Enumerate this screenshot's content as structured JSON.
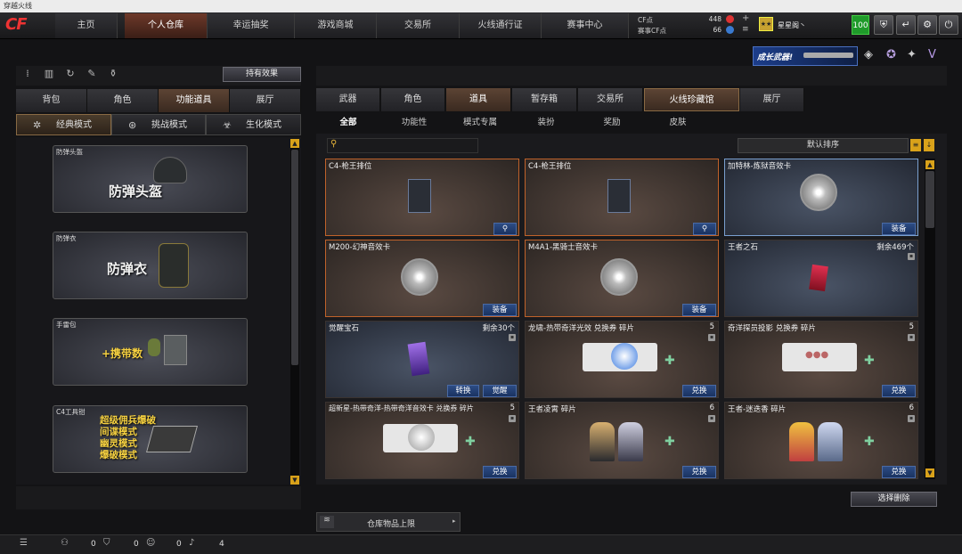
{
  "window": {
    "title": "穿越火线"
  },
  "logo": "CF",
  "nav": {
    "tabs": [
      "主页",
      "个人仓库",
      "幸运抽奖",
      "游戏商城",
      "交易所",
      "火线通行证",
      "赛事中心"
    ]
  },
  "currency": {
    "cf_label": "CF点",
    "cf_value": "448",
    "event_label": "赛事CF点",
    "event_value": "66"
  },
  "user": {
    "name": "星星阁丶",
    "level": "100"
  },
  "left": {
    "effect_button": "持有效果",
    "tabs": [
      "背包",
      "角色",
      "功能道具",
      "展厅"
    ],
    "modes": [
      "经典模式",
      "挑战模式",
      "生化模式"
    ],
    "cards": [
      {
        "label": "防弹头盔",
        "text": "防弹头盔"
      },
      {
        "label": "防弹衣",
        "text": "防弹衣"
      },
      {
        "label": "手雷包",
        "text": "+携带数"
      },
      {
        "label": "C4工具钳",
        "lines": [
          "超级佣兵爆破",
          "间谍模式",
          "幽灵模式",
          "爆破模式"
        ]
      }
    ]
  },
  "banner": {
    "text": "成长武器!"
  },
  "right": {
    "tabs": [
      "武器",
      "角色",
      "道具",
      "暂存箱",
      "交易所",
      "火线珍藏馆",
      "展厅"
    ],
    "subtabs": [
      "全部",
      "功能性",
      "模式专属",
      "装扮",
      "奖励",
      "皮肤"
    ],
    "sort_label": "默认排序",
    "items": [
      {
        "name": "C4-枪王排位",
        "count": "",
        "buttons": [
          "search-icon"
        ]
      },
      {
        "name": "C4-枪王排位",
        "count": "",
        "buttons": [
          "search-icon"
        ]
      },
      {
        "name": "加特林-炼狱音效卡",
        "count": "",
        "buttons": [
          "装备"
        ]
      },
      {
        "name": "M200-幻神音效卡",
        "count": "",
        "buttons": [
          "装备"
        ]
      },
      {
        "name": "M4A1-黑骑士音效卡",
        "count": "",
        "buttons": [
          "装备"
        ]
      },
      {
        "name": "王者之石",
        "count": "剩余469个",
        "buttons": []
      },
      {
        "name": "觉醒宝石",
        "count": "剩余30个",
        "buttons": [
          "转换",
          "觉醒"
        ]
      },
      {
        "name": "龙啸-热带奇洋光效 兑换券 碎片",
        "count": "5",
        "buttons": [
          "兑换"
        ]
      },
      {
        "name": "奇洋探员投影 兑换券 碎片",
        "count": "5",
        "buttons": [
          "兑换"
        ]
      },
      {
        "name": "超新星-热带奇洋-热带奇洋音效卡 兑换券 碎片",
        "count": "5",
        "buttons": [
          "兑换"
        ]
      },
      {
        "name": "王者凌霄 碎片",
        "count": "6",
        "buttons": [
          "兑换"
        ]
      },
      {
        "name": "王者-迷迭香 碎片",
        "count": "6",
        "buttons": [
          "兑换"
        ]
      }
    ],
    "delete_button": "选择删除",
    "storage_limit": "仓库物品上限"
  },
  "footer": {
    "counts": [
      "0",
      "0",
      "0",
      "4"
    ]
  }
}
